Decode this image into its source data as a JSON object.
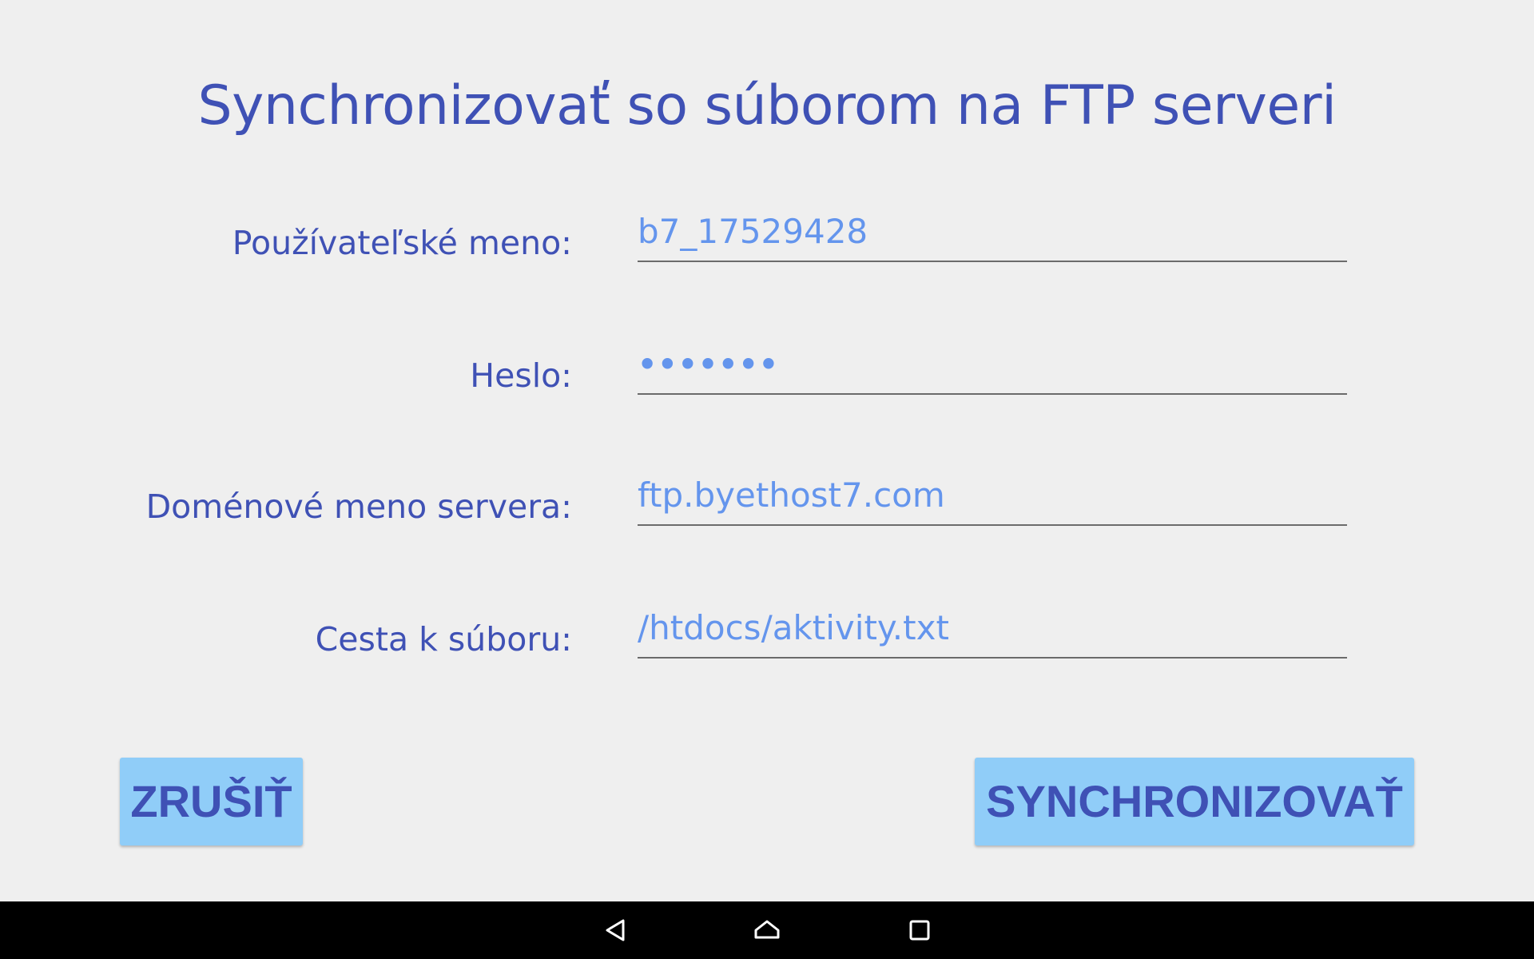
{
  "dialog": {
    "title": "Synchronizovať so súborom na FTP serveri"
  },
  "form": {
    "fields": [
      {
        "label": "Používateľské meno:",
        "value": "b7_17529428"
      },
      {
        "label": "Heslo:",
        "value": "•••••••"
      },
      {
        "label": "Doménové meno servera:",
        "value": "ftp.byethost7.com"
      },
      {
        "label": "Cesta k súboru:",
        "value": "/htdocs/aktivity.txt"
      }
    ]
  },
  "actions": {
    "cancel_label": "ZRUŠIŤ",
    "sync_label": "SYNCHRONIZOVAŤ"
  },
  "navbar": {
    "icons": [
      "back-icon",
      "home-icon",
      "recents-icon"
    ]
  },
  "colors": {
    "accent": "#3f51b5",
    "field_text": "#6495ed",
    "button_bg": "#90cdf8",
    "background": "#efefef",
    "navbar": "#000000"
  }
}
